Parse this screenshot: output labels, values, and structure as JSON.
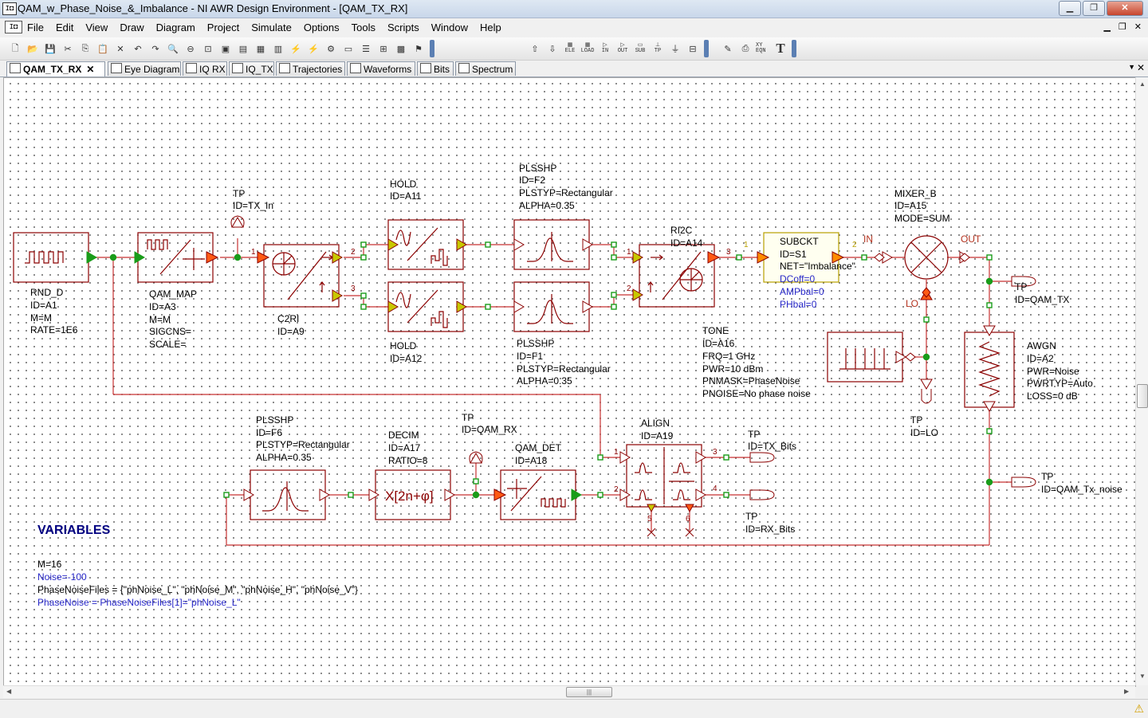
{
  "window": {
    "title": "QAM_w_Phase_Noise_&_Imbalance - NI AWR Design Environment - [QAM_TX_RX]",
    "minimize": "▁",
    "maximize": "❐",
    "close": "✕"
  },
  "menubar": {
    "items": [
      "File",
      "Edit",
      "View",
      "Draw",
      "Diagram",
      "Project",
      "Simulate",
      "Options",
      "Tools",
      "Scripts",
      "Window",
      "Help"
    ],
    "mdi_minimize": "▁",
    "mdi_restore": "❐",
    "mdi_close": "✕"
  },
  "toolbar": {
    "icons": [
      "new-icon",
      "open-icon",
      "save-icon",
      "cut-icon",
      "copy-icon",
      "paste-icon",
      "delete-icon",
      "undo-icon",
      "redo-icon",
      "zoom-area-icon",
      "zoom-out-icon",
      "zoom-fit-icon",
      "view-all-icon",
      "add-schematic-icon",
      "add-graph-icon",
      "add-eqn-icon",
      "analyze-icon",
      "tune-icon",
      "tune-tool-icon",
      "add-sweep-icon",
      "bus-icon",
      "port-icon",
      "netlist-icon",
      "optimize-icon",
      "up-icon",
      "down-icon"
    ],
    "small_labels": [
      "ELE",
      "LOAD",
      "IN",
      "OUT",
      "SUB",
      "TP",
      "XY EQN"
    ],
    "text_tool": "T"
  },
  "tabs": [
    {
      "label": "QAM_TX_RX",
      "active": true
    },
    {
      "label": "Eye Diagram"
    },
    {
      "label": "IQ RX"
    },
    {
      "label": "IQ_TX"
    },
    {
      "label": "Trajectories"
    },
    {
      "label": "Waveforms"
    },
    {
      "label": "Bits"
    },
    {
      "label": "Spectrum"
    }
  ],
  "tab_close": "✕",
  "tab_list_arrow": "▼",
  "schematic": {
    "rnd_d": [
      "RND_D",
      "ID=A1",
      "M=M",
      "RATE=1E6"
    ],
    "qam_map": [
      "QAM_MAP",
      "ID=A3",
      "M=M",
      "SIGCNS=",
      "SCALE="
    ],
    "tp_tx_in": [
      "TP",
      "ID=TX_In"
    ],
    "c2ri": [
      "C2RI",
      "ID=A9"
    ],
    "hold_a11": [
      "HOLD",
      "ID=A11"
    ],
    "hold_a12": [
      "HOLD",
      "ID=A12"
    ],
    "plsshp_f2": [
      "PLSSHP",
      "ID=F2",
      "PLSTYP=Rectangular",
      "ALPHA=0.35"
    ],
    "plsshp_f1": [
      "PLSSHP",
      "ID=F1",
      "PLSTYP=Rectangular",
      "ALPHA=0.35"
    ],
    "ri2c": [
      "RI2C",
      "ID=A14"
    ],
    "subckt": [
      "SUBCKT",
      "ID=S1",
      "NET=\"Imbalance\""
    ],
    "subckt_params": [
      "DCoff=0",
      "AMPbal=0",
      "PHbal=0"
    ],
    "mixer": [
      "MIXER_B",
      "ID=A15",
      "MODE=SUM"
    ],
    "mixer_ports": [
      "IN",
      "OUT",
      "LO"
    ],
    "tone": [
      "TONE",
      "ID=A16",
      "FRQ=1 GHz",
      "PWR=10 dBm",
      "PNMASK=PhaseNoise",
      "PNOISE=No phase noise"
    ],
    "tp_lo": [
      "TP",
      "ID=LO"
    ],
    "tp_qam_tx": [
      "TP",
      "ID=QAM_TX"
    ],
    "awgn": [
      "AWGN",
      "ID=A2",
      "PWR=Noise",
      "PWRTYP=Auto",
      "LOSS=0 dB"
    ],
    "tp_qam_tx_noise": [
      "TP",
      "ID=QAM_Tx_noise"
    ],
    "plsshp_f6": [
      "PLSSHP",
      "ID=F6",
      "PLSTYP=Rectangular",
      "ALPHA=0.35"
    ],
    "decim": [
      "DECIM",
      "ID=A17",
      "RATIO=8"
    ],
    "tp_qam_rx": [
      "TP",
      "ID=QAM_RX"
    ],
    "qam_det": [
      "QAM_DET",
      "ID=A18"
    ],
    "align": [
      "ALIGN",
      "ID=A19"
    ],
    "tp_tx_bits": [
      "TP",
      "ID=TX_Bits"
    ],
    "tp_rx_bits": [
      "TP",
      "ID=RX_Bits"
    ],
    "pin_numbers": {
      "c2ri_in": "1",
      "c2ri_out2": "2",
      "c2ri_out3": "3",
      "ri2c_in1": "1",
      "ri2c_in2": "2",
      "ri2c_out": "3",
      "sub_in": "1",
      "sub_out": "2",
      "align_in1": "1",
      "align_in2": "2",
      "align_out3": "3",
      "align_out4": "4",
      "align_out5": "5",
      "align_out6": "6"
    },
    "decim_symbol": "X[2n+φ]"
  },
  "variables": {
    "header": "VARIABLES",
    "lines": [
      "M=16",
      "Noise=-100",
      "PhaseNoiseFiles = {\"phNoise_L\", \"phNoise_M\", \"phNoise_H\", \"phNoise_V\"}",
      "PhaseNoise = PhaseNoiseFiles[1]=\"phNoise_L\""
    ]
  },
  "scrollbar_grip": "|||",
  "status_warning": "⚠",
  "colors": {
    "wire": "#c83232",
    "element": "#8b0000",
    "node": "#1a9c1a",
    "port_fill": "#c8c800",
    "accent_orange": "#ff5a14",
    "param_blue": "#2828c8",
    "var_header": "#000080"
  }
}
